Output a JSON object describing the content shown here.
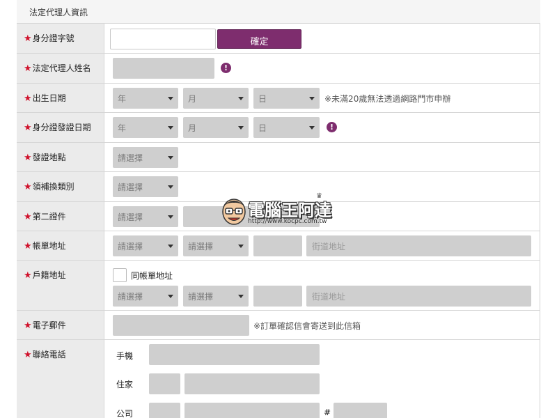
{
  "section": {
    "title": "法定代理人資訊"
  },
  "rows": {
    "id_number": {
      "label": "身分證字號",
      "confirm": "確定"
    },
    "guardian_name": {
      "label": "法定代理人姓名"
    },
    "birth_date": {
      "label": "出生日期",
      "year": "年",
      "month": "月",
      "day": "日",
      "note": "※未滿20歲無法透過網路門市申辦"
    },
    "id_issue_date": {
      "label": "身分證發證日期",
      "year": "年",
      "month": "月",
      "day": "日"
    },
    "issue_place": {
      "label": "發證地點",
      "select": "請選擇"
    },
    "issue_type": {
      "label": "領補換類別",
      "select": "請選擇"
    },
    "second_id": {
      "label": "第二證件",
      "select": "請選擇"
    },
    "billing_address": {
      "label": "帳單地址",
      "city": "請選擇",
      "district": "請選擇",
      "street_placeholder": "街道地址"
    },
    "household_address": {
      "label": "戶籍地址",
      "same_as_billing": "同帳單地址",
      "city": "請選擇",
      "district": "請選擇",
      "street_placeholder": "街道地址"
    },
    "email": {
      "label": "電子郵件",
      "note": "※訂單確認信會寄送到此信箱"
    },
    "phone": {
      "label": "聯絡電話",
      "mobile": "手機",
      "home": "住家",
      "office": "公司",
      "ext": "#"
    }
  },
  "star": "★",
  "warn_symbol": "!",
  "watermark": {
    "title": "電腦王阿達",
    "url": "http://www.kocpc.com.tw"
  },
  "colors": {
    "accent": "#7e2d6e",
    "required": "#d0112b",
    "field": "#cfcfcf",
    "label_bg": "#ebebeb"
  }
}
